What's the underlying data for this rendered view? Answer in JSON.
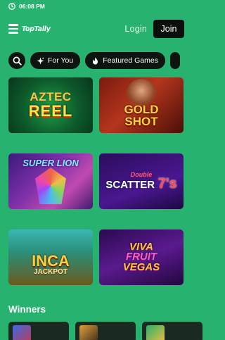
{
  "status_bar": {
    "time": "06:08 PM"
  },
  "header": {
    "logo_text": "TopTally",
    "login_label": "Login",
    "join_label": "Join"
  },
  "filters": {
    "search_icon": "search-icon",
    "chips": [
      {
        "label": "For You",
        "icon": "sparkle-icon"
      },
      {
        "label": "Featured Games",
        "icon": "flame-icon"
      }
    ]
  },
  "games": [
    {
      "line1": "AZTEC",
      "line2": "REEL"
    },
    {
      "line1": "GOLD",
      "line2": "SHOT"
    },
    {
      "line1": "SUPER LION"
    },
    {
      "line1": "Double",
      "line2": "SCATTER",
      "line3": "7's"
    },
    {
      "line1": "INCA",
      "line2": "JACKPOT"
    },
    {
      "line1": "VIVA",
      "line2": "FRUIT",
      "line3": "VEGAS"
    }
  ],
  "winners": {
    "title": "Winners"
  },
  "colors": {
    "background": "#27b36f",
    "chip_bg": "#0e1410",
    "join_bg": "#0b0f0c",
    "login_text": "#d6ffe9"
  }
}
